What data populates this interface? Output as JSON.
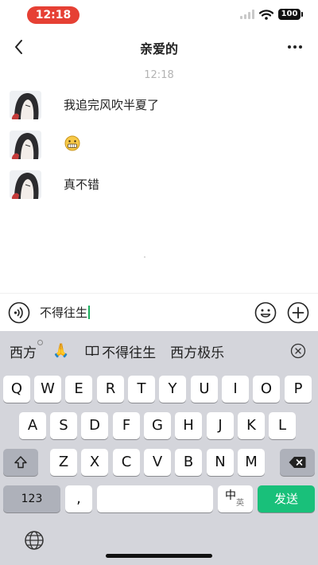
{
  "status_bar": {
    "time": "12:18",
    "battery": "100"
  },
  "header": {
    "title": "亲爱的"
  },
  "chat": {
    "timestamp": "12:18",
    "messages": [
      {
        "type": "text",
        "text": "我追完风吹半夏了"
      },
      {
        "type": "emoji",
        "emoji": "face-with-teeth-emoji"
      },
      {
        "type": "text",
        "text": "真不错"
      }
    ]
  },
  "input": {
    "value": "不得往生"
  },
  "keyboard": {
    "candidates": [
      "西方",
      "🙏",
      "不得往生",
      "西方极乐"
    ],
    "row1": [
      "Q",
      "W",
      "E",
      "R",
      "T",
      "Y",
      "U",
      "I",
      "O",
      "P"
    ],
    "row2": [
      "A",
      "S",
      "D",
      "F",
      "G",
      "H",
      "J",
      "K",
      "L"
    ],
    "row3": [
      "Z",
      "X",
      "C",
      "V",
      "B",
      "N",
      "M"
    ],
    "numbers_label": "123",
    "comma_label": ",",
    "lang_main": "中",
    "lang_sub": "英",
    "send_label": "发送"
  },
  "colors": {
    "accent": "#19c07a",
    "time_pill": "#e64034"
  }
}
